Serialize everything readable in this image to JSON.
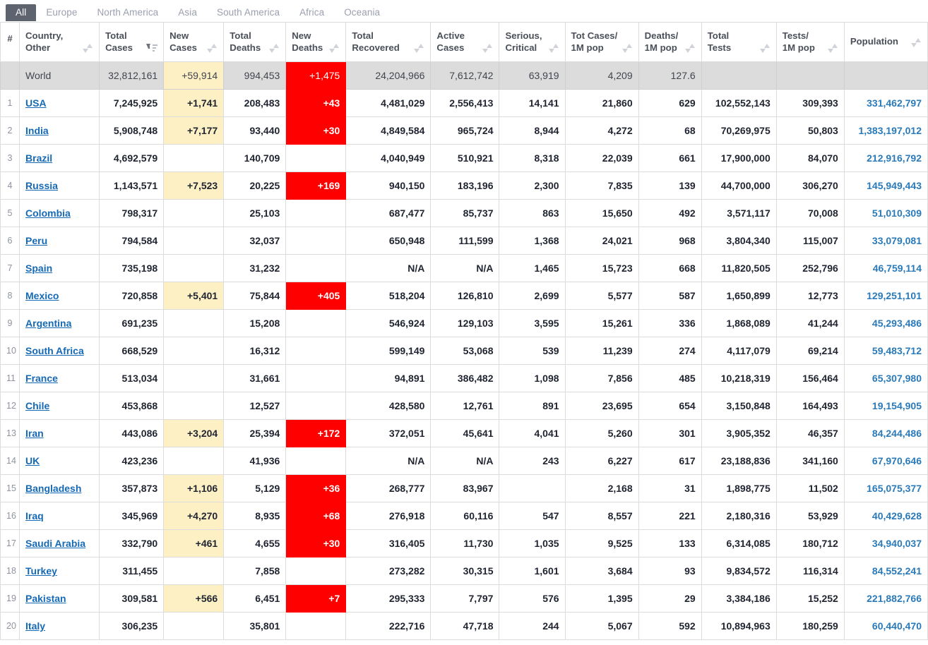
{
  "tabs": [
    {
      "label": "All",
      "active": true
    },
    {
      "label": "Europe",
      "active": false
    },
    {
      "label": "North America",
      "active": false
    },
    {
      "label": "Asia",
      "active": false
    },
    {
      "label": "South America",
      "active": false
    },
    {
      "label": "Africa",
      "active": false
    },
    {
      "label": "Oceania",
      "active": false
    }
  ],
  "table": {
    "columns": [
      {
        "key": "rank",
        "label": "#",
        "label2": "",
        "sort": "dual"
      },
      {
        "key": "country",
        "label": "Country,",
        "label2": "Other",
        "sort": "dual"
      },
      {
        "key": "total_cases",
        "label": "Total",
        "label2": "Cases",
        "sort": "desc"
      },
      {
        "key": "new_cases",
        "label": "New",
        "label2": "Cases",
        "sort": "dual"
      },
      {
        "key": "total_deaths",
        "label": "Total",
        "label2": "Deaths",
        "sort": "dual"
      },
      {
        "key": "new_deaths",
        "label": "New",
        "label2": "Deaths",
        "sort": "dual"
      },
      {
        "key": "total_recovered",
        "label": "Total",
        "label2": "Recovered",
        "sort": "dual"
      },
      {
        "key": "active_cases",
        "label": "Active",
        "label2": "Cases",
        "sort": "dual"
      },
      {
        "key": "serious_critical",
        "label": "Serious,",
        "label2": "Critical",
        "sort": "dual"
      },
      {
        "key": "cases_per_1m",
        "label": "Tot Cases/",
        "label2": "1M pop",
        "sort": "dual"
      },
      {
        "key": "deaths_per_1m",
        "label": "Deaths/",
        "label2": "1M pop",
        "sort": "dual"
      },
      {
        "key": "total_tests",
        "label": "Total",
        "label2": "Tests",
        "sort": "dual"
      },
      {
        "key": "tests_per_1m",
        "label": "Tests/",
        "label2": "1M pop",
        "sort": "dual"
      },
      {
        "key": "population",
        "label": "",
        "label2": "Population",
        "sort": "dual"
      }
    ],
    "world_row": {
      "rank": "",
      "country": "World",
      "total_cases": "32,812,161",
      "new_cases": "+59,914",
      "total_deaths": "994,453",
      "new_deaths": "+1,475",
      "total_recovered": "24,204,966",
      "active_cases": "7,612,742",
      "serious_critical": "63,919",
      "cases_per_1m": "4,209",
      "deaths_per_1m": "127.6",
      "total_tests": "",
      "tests_per_1m": "",
      "population": ""
    },
    "rows": [
      {
        "rank": "1",
        "country": "USA",
        "total_cases": "7,245,925",
        "new_cases": "+1,741",
        "total_deaths": "208,483",
        "new_deaths": "+43",
        "total_recovered": "4,481,029",
        "active_cases": "2,556,413",
        "serious_critical": "14,141",
        "cases_per_1m": "21,860",
        "deaths_per_1m": "629",
        "total_tests": "102,552,143",
        "tests_per_1m": "309,393",
        "population": "331,462,797"
      },
      {
        "rank": "2",
        "country": "India",
        "total_cases": "5,908,748",
        "new_cases": "+7,177",
        "total_deaths": "93,440",
        "new_deaths": "+30",
        "total_recovered": "4,849,584",
        "active_cases": "965,724",
        "serious_critical": "8,944",
        "cases_per_1m": "4,272",
        "deaths_per_1m": "68",
        "total_tests": "70,269,975",
        "tests_per_1m": "50,803",
        "population": "1,383,197,012"
      },
      {
        "rank": "3",
        "country": "Brazil",
        "total_cases": "4,692,579",
        "new_cases": "",
        "total_deaths": "140,709",
        "new_deaths": "",
        "total_recovered": "4,040,949",
        "active_cases": "510,921",
        "serious_critical": "8,318",
        "cases_per_1m": "22,039",
        "deaths_per_1m": "661",
        "total_tests": "17,900,000",
        "tests_per_1m": "84,070",
        "population": "212,916,792"
      },
      {
        "rank": "4",
        "country": "Russia",
        "total_cases": "1,143,571",
        "new_cases": "+7,523",
        "total_deaths": "20,225",
        "new_deaths": "+169",
        "total_recovered": "940,150",
        "active_cases": "183,196",
        "serious_critical": "2,300",
        "cases_per_1m": "7,835",
        "deaths_per_1m": "139",
        "total_tests": "44,700,000",
        "tests_per_1m": "306,270",
        "population": "145,949,443"
      },
      {
        "rank": "5",
        "country": "Colombia",
        "total_cases": "798,317",
        "new_cases": "",
        "total_deaths": "25,103",
        "new_deaths": "",
        "total_recovered": "687,477",
        "active_cases": "85,737",
        "serious_critical": "863",
        "cases_per_1m": "15,650",
        "deaths_per_1m": "492",
        "total_tests": "3,571,117",
        "tests_per_1m": "70,008",
        "population": "51,010,309"
      },
      {
        "rank": "6",
        "country": "Peru",
        "total_cases": "794,584",
        "new_cases": "",
        "total_deaths": "32,037",
        "new_deaths": "",
        "total_recovered": "650,948",
        "active_cases": "111,599",
        "serious_critical": "1,368",
        "cases_per_1m": "24,021",
        "deaths_per_1m": "968",
        "total_tests": "3,804,340",
        "tests_per_1m": "115,007",
        "population": "33,079,081"
      },
      {
        "rank": "7",
        "country": "Spain",
        "total_cases": "735,198",
        "new_cases": "",
        "total_deaths": "31,232",
        "new_deaths": "",
        "total_recovered": "N/A",
        "active_cases": "N/A",
        "serious_critical": "1,465",
        "cases_per_1m": "15,723",
        "deaths_per_1m": "668",
        "total_tests": "11,820,505",
        "tests_per_1m": "252,796",
        "population": "46,759,114"
      },
      {
        "rank": "8",
        "country": "Mexico",
        "total_cases": "720,858",
        "new_cases": "+5,401",
        "total_deaths": "75,844",
        "new_deaths": "+405",
        "total_recovered": "518,204",
        "active_cases": "126,810",
        "serious_critical": "2,699",
        "cases_per_1m": "5,577",
        "deaths_per_1m": "587",
        "total_tests": "1,650,899",
        "tests_per_1m": "12,773",
        "population": "129,251,101"
      },
      {
        "rank": "9",
        "country": "Argentina",
        "total_cases": "691,235",
        "new_cases": "",
        "total_deaths": "15,208",
        "new_deaths": "",
        "total_recovered": "546,924",
        "active_cases": "129,103",
        "serious_critical": "3,595",
        "cases_per_1m": "15,261",
        "deaths_per_1m": "336",
        "total_tests": "1,868,089",
        "tests_per_1m": "41,244",
        "population": "45,293,486"
      },
      {
        "rank": "10",
        "country": "South Africa",
        "total_cases": "668,529",
        "new_cases": "",
        "total_deaths": "16,312",
        "new_deaths": "",
        "total_recovered": "599,149",
        "active_cases": "53,068",
        "serious_critical": "539",
        "cases_per_1m": "11,239",
        "deaths_per_1m": "274",
        "total_tests": "4,117,079",
        "tests_per_1m": "69,214",
        "population": "59,483,712"
      },
      {
        "rank": "11",
        "country": "France",
        "total_cases": "513,034",
        "new_cases": "",
        "total_deaths": "31,661",
        "new_deaths": "",
        "total_recovered": "94,891",
        "active_cases": "386,482",
        "serious_critical": "1,098",
        "cases_per_1m": "7,856",
        "deaths_per_1m": "485",
        "total_tests": "10,218,319",
        "tests_per_1m": "156,464",
        "population": "65,307,980"
      },
      {
        "rank": "12",
        "country": "Chile",
        "total_cases": "453,868",
        "new_cases": "",
        "total_deaths": "12,527",
        "new_deaths": "",
        "total_recovered": "428,580",
        "active_cases": "12,761",
        "serious_critical": "891",
        "cases_per_1m": "23,695",
        "deaths_per_1m": "654",
        "total_tests": "3,150,848",
        "tests_per_1m": "164,493",
        "population": "19,154,905"
      },
      {
        "rank": "13",
        "country": "Iran",
        "total_cases": "443,086",
        "new_cases": "+3,204",
        "total_deaths": "25,394",
        "new_deaths": "+172",
        "total_recovered": "372,051",
        "active_cases": "45,641",
        "serious_critical": "4,041",
        "cases_per_1m": "5,260",
        "deaths_per_1m": "301",
        "total_tests": "3,905,352",
        "tests_per_1m": "46,357",
        "population": "84,244,486"
      },
      {
        "rank": "14",
        "country": "UK",
        "total_cases": "423,236",
        "new_cases": "",
        "total_deaths": "41,936",
        "new_deaths": "",
        "total_recovered": "N/A",
        "active_cases": "N/A",
        "serious_critical": "243",
        "cases_per_1m": "6,227",
        "deaths_per_1m": "617",
        "total_tests": "23,188,836",
        "tests_per_1m": "341,160",
        "population": "67,970,646"
      },
      {
        "rank": "15",
        "country": "Bangladesh",
        "total_cases": "357,873",
        "new_cases": "+1,106",
        "total_deaths": "5,129",
        "new_deaths": "+36",
        "total_recovered": "268,777",
        "active_cases": "83,967",
        "serious_critical": "",
        "cases_per_1m": "2,168",
        "deaths_per_1m": "31",
        "total_tests": "1,898,775",
        "tests_per_1m": "11,502",
        "population": "165,075,377"
      },
      {
        "rank": "16",
        "country": "Iraq",
        "total_cases": "345,969",
        "new_cases": "+4,270",
        "total_deaths": "8,935",
        "new_deaths": "+68",
        "total_recovered": "276,918",
        "active_cases": "60,116",
        "serious_critical": "547",
        "cases_per_1m": "8,557",
        "deaths_per_1m": "221",
        "total_tests": "2,180,316",
        "tests_per_1m": "53,929",
        "population": "40,429,628"
      },
      {
        "rank": "17",
        "country": "Saudi Arabia",
        "total_cases": "332,790",
        "new_cases": "+461",
        "total_deaths": "4,655",
        "new_deaths": "+30",
        "total_recovered": "316,405",
        "active_cases": "11,730",
        "serious_critical": "1,035",
        "cases_per_1m": "9,525",
        "deaths_per_1m": "133",
        "total_tests": "6,314,085",
        "tests_per_1m": "180,712",
        "population": "34,940,037"
      },
      {
        "rank": "18",
        "country": "Turkey",
        "total_cases": "311,455",
        "new_cases": "",
        "total_deaths": "7,858",
        "new_deaths": "",
        "total_recovered": "273,282",
        "active_cases": "30,315",
        "serious_critical": "1,601",
        "cases_per_1m": "3,684",
        "deaths_per_1m": "93",
        "total_tests": "9,834,572",
        "tests_per_1m": "116,314",
        "population": "84,552,241"
      },
      {
        "rank": "19",
        "country": "Pakistan",
        "total_cases": "309,581",
        "new_cases": "+566",
        "total_deaths": "6,451",
        "new_deaths": "+7",
        "total_recovered": "295,333",
        "active_cases": "7,797",
        "serious_critical": "576",
        "cases_per_1m": "1,395",
        "deaths_per_1m": "29",
        "total_tests": "3,384,186",
        "tests_per_1m": "15,252",
        "population": "221,882,766"
      },
      {
        "rank": "20",
        "country": "Italy",
        "total_cases": "306,235",
        "new_cases": "",
        "total_deaths": "35,801",
        "new_deaths": "",
        "total_recovered": "222,716",
        "active_cases": "47,718",
        "serious_critical": "244",
        "cases_per_1m": "5,067",
        "deaths_per_1m": "592",
        "total_tests": "10,894,963",
        "tests_per_1m": "180,259",
        "population": "60,440,470"
      }
    ]
  },
  "colors": {
    "active_tab_bg": "#5d6470",
    "new_cases_highlight": "#fdf0c5",
    "new_deaths_highlight": "#ff0000",
    "world_row_bg": "#dcdcdc",
    "link": "#1569b5",
    "population": "#2a7ab9"
  }
}
